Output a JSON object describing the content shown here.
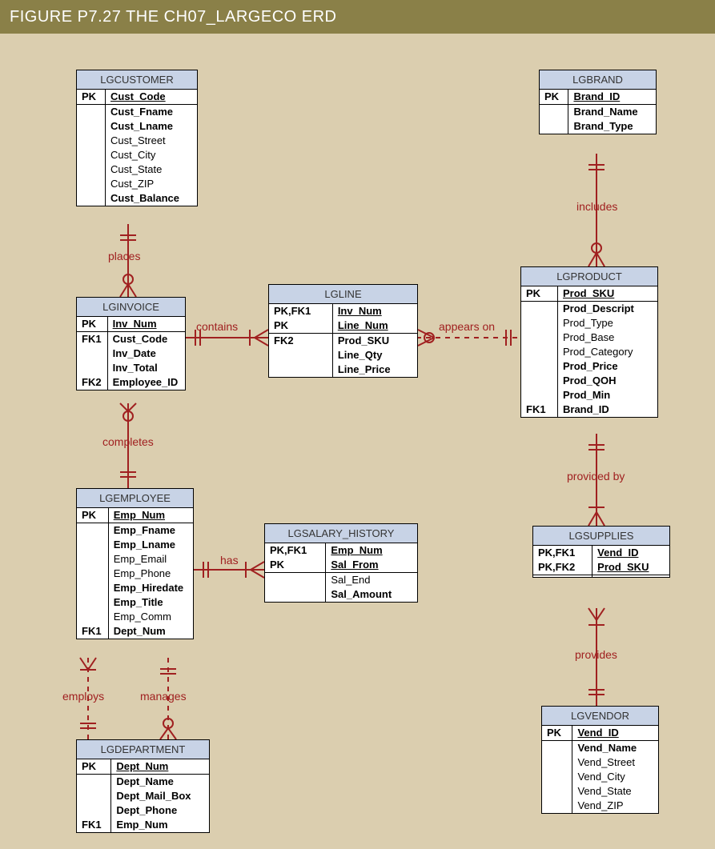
{
  "title": "FIGURE P7.27  THE CH07_LARGECO ERD",
  "colors": {
    "bg": "#dbceaf",
    "header": "#8a8048",
    "entityHead": "#c8d3e6",
    "line": "#a02020"
  },
  "entities": {
    "lgcustomer": {
      "name": "LGCUSTOMER",
      "pk": [
        {
          "key": "PK",
          "attr": "Cust_Code",
          "bold": true,
          "pk": true
        }
      ],
      "attrs": [
        {
          "key": "",
          "attr": "Cust_Fname",
          "bold": true
        },
        {
          "key": "",
          "attr": "Cust_Lname",
          "bold": true
        },
        {
          "key": "",
          "attr": "Cust_Street"
        },
        {
          "key": "",
          "attr": "Cust_City"
        },
        {
          "key": "",
          "attr": "Cust_State"
        },
        {
          "key": "",
          "attr": "Cust_ZIP"
        },
        {
          "key": "",
          "attr": "Cust_Balance",
          "bold": true
        }
      ]
    },
    "lginvoice": {
      "name": "LGINVOICE",
      "pk": [
        {
          "key": "PK",
          "attr": "Inv_Num",
          "bold": true,
          "pk": true
        }
      ],
      "attrs": [
        {
          "key": "FK1",
          "attr": "Cust_Code",
          "bold": true
        },
        {
          "key": "",
          "attr": "Inv_Date",
          "bold": true
        },
        {
          "key": "",
          "attr": "Inv_Total",
          "bold": true
        },
        {
          "key": "FK2",
          "attr": "Employee_ID",
          "bold": true
        }
      ]
    },
    "lgline": {
      "name": "LGLINE",
      "pk": [
        {
          "key": "PK,FK1",
          "attr": "Inv_Num",
          "bold": true,
          "pk": true
        },
        {
          "key": "PK",
          "attr": "Line_Num",
          "bold": true,
          "pk": true
        }
      ],
      "attrs": [
        {
          "key": "FK2",
          "attr": "Prod_SKU",
          "bold": true
        },
        {
          "key": "",
          "attr": "Line_Qty",
          "bold": true
        },
        {
          "key": "",
          "attr": "Line_Price",
          "bold": true
        }
      ]
    },
    "lgbrand": {
      "name": "LGBRAND",
      "pk": [
        {
          "key": "PK",
          "attr": "Brand_ID",
          "bold": true,
          "pk": true
        }
      ],
      "attrs": [
        {
          "key": "",
          "attr": "Brand_Name",
          "bold": true
        },
        {
          "key": "",
          "attr": "Brand_Type",
          "bold": true
        }
      ]
    },
    "lgproduct": {
      "name": "LGPRODUCT",
      "pk": [
        {
          "key": "PK",
          "attr": "Prod_SKU",
          "bold": true,
          "pk": true
        }
      ],
      "attrs": [
        {
          "key": "",
          "attr": "Prod_Descript",
          "bold": true
        },
        {
          "key": "",
          "attr": "Prod_Type"
        },
        {
          "key": "",
          "attr": "Prod_Base"
        },
        {
          "key": "",
          "attr": "Prod_Category"
        },
        {
          "key": "",
          "attr": "Prod_Price",
          "bold": true
        },
        {
          "key": "",
          "attr": "Prod_QOH",
          "bold": true
        },
        {
          "key": "",
          "attr": "Prod_Min",
          "bold": true
        },
        {
          "key": "FK1",
          "attr": "Brand_ID",
          "bold": true
        }
      ]
    },
    "lgemployee": {
      "name": "LGEMPLOYEE",
      "pk": [
        {
          "key": "PK",
          "attr": "Emp_Num",
          "bold": true,
          "pk": true
        }
      ],
      "attrs": [
        {
          "key": "",
          "attr": "Emp_Fname",
          "bold": true
        },
        {
          "key": "",
          "attr": "Emp_Lname",
          "bold": true
        },
        {
          "key": "",
          "attr": "Emp_Email"
        },
        {
          "key": "",
          "attr": "Emp_Phone"
        },
        {
          "key": "",
          "attr": "Emp_Hiredate",
          "bold": true
        },
        {
          "key": "",
          "attr": "Emp_Title",
          "bold": true
        },
        {
          "key": "",
          "attr": "Emp_Comm"
        },
        {
          "key": "FK1",
          "attr": "Dept_Num",
          "bold": true
        }
      ]
    },
    "lgsalary_history": {
      "name": "LGSALARY_HISTORY",
      "pk": [
        {
          "key": "PK,FK1",
          "attr": "Emp_Num",
          "bold": true,
          "pk": true
        },
        {
          "key": "PK",
          "attr": "Sal_From",
          "bold": true,
          "pk": true
        }
      ],
      "attrs": [
        {
          "key": "",
          "attr": "Sal_End"
        },
        {
          "key": "",
          "attr": "Sal_Amount",
          "bold": true
        }
      ]
    },
    "lgsupplies": {
      "name": "LGSUPPLIES",
      "pk": [
        {
          "key": "PK,FK1",
          "attr": "Vend_ID",
          "bold": true,
          "pk": true
        },
        {
          "key": "PK,FK2",
          "attr": "Prod_SKU",
          "bold": true,
          "pk": true
        }
      ],
      "attrs": [
        {
          "key": "",
          "attr": " "
        }
      ]
    },
    "lgdepartment": {
      "name": "LGDEPARTMENT",
      "pk": [
        {
          "key": "PK",
          "attr": "Dept_Num",
          "bold": true,
          "pk": true
        }
      ],
      "attrs": [
        {
          "key": "",
          "attr": "Dept_Name",
          "bold": true
        },
        {
          "key": "",
          "attr": "Dept_Mail_Box",
          "bold": true
        },
        {
          "key": "",
          "attr": "Dept_Phone",
          "bold": true
        },
        {
          "key": "FK1",
          "attr": "Emp_Num",
          "bold": true
        }
      ]
    },
    "lgvendor": {
      "name": "LGVENDOR",
      "pk": [
        {
          "key": "PK",
          "attr": "Vend_ID",
          "bold": true,
          "pk": true
        }
      ],
      "attrs": [
        {
          "key": "",
          "attr": "Vend_Name",
          "bold": true
        },
        {
          "key": "",
          "attr": "Vend_Street"
        },
        {
          "key": "",
          "attr": "Vend_City"
        },
        {
          "key": "",
          "attr": "Vend_State"
        },
        {
          "key": "",
          "attr": "Vend_ZIP"
        }
      ]
    }
  },
  "relationships": {
    "places": "places",
    "contains": "contains",
    "appears_on": "appears on",
    "includes": "includes",
    "completes": "completes",
    "has": "has",
    "employs": "employs",
    "manages": "manages",
    "provided_by": "provided by",
    "provides": "provides"
  }
}
